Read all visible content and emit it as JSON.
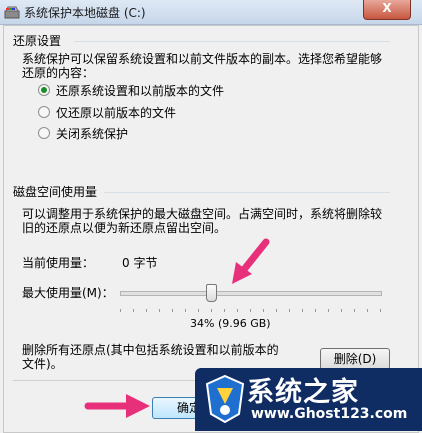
{
  "window": {
    "title": "系统保护本地磁盘 (C:)",
    "close_label": "X"
  },
  "restore_settings": {
    "group_label": "还原设置",
    "description_line1": "系统保护可以保留系统设置和以前文件版本的副本。选择您希望能够",
    "description_line2": "还原的内容：",
    "options": [
      {
        "label": "还原系统设置和以前版本的文件",
        "selected": true
      },
      {
        "label": "仅还原以前版本的文件",
        "selected": false
      },
      {
        "label": "关闭系统保护",
        "selected": false
      }
    ]
  },
  "disk_usage": {
    "group_label": "磁盘空间使用量",
    "description_line1": "可以调整用于系统保护的最大磁盘空间。占满空间时，系统将删除较",
    "description_line2": "旧的还原点以便为新还原点留出空间。",
    "current_usage_label": "当前使用量：",
    "current_usage_value": "0 字节",
    "max_usage_label": "最大使用量(M)：",
    "max_usage_percent": 34,
    "max_usage_text": "34% (9.96 GB)",
    "delete_text_line1": "删除所有还原点(其中包括系统设置和以前版本的",
    "delete_text_line2": "文件)。",
    "delete_button": "删除(D)"
  },
  "footer": {
    "ok_button": "确定"
  },
  "watermark": {
    "title": "系统之家",
    "url": "www.Ghost123.com"
  },
  "colors": {
    "arrow": "#e8307a",
    "radio_dot": "#1a8c2a",
    "watermark_bg": "#0f2d63"
  }
}
